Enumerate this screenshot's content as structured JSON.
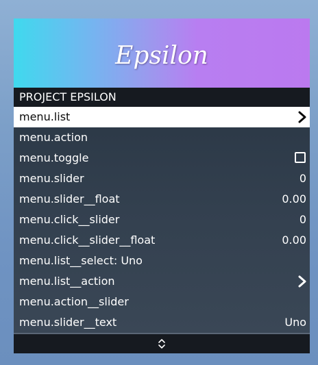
{
  "banner": {
    "title": "Epsilon",
    "gradient_start": "#3fd9ee",
    "gradient_end": "#bb79ef"
  },
  "subtitle": "PROJECT EPSILON",
  "items": [
    {
      "label": "menu.list",
      "value": "",
      "kind": "submenu",
      "selected": true
    },
    {
      "label": "menu.action",
      "value": "",
      "kind": "action"
    },
    {
      "label": "menu.toggle",
      "value": "",
      "kind": "toggle",
      "checked": false
    },
    {
      "label": "menu.slider",
      "value": "0",
      "kind": "slider"
    },
    {
      "label": "menu.slider__float",
      "value": "0.00",
      "kind": "slider"
    },
    {
      "label": "menu.click__slider",
      "value": "0",
      "kind": "slider"
    },
    {
      "label": "menu.click__slider__float",
      "value": "0.00",
      "kind": "slider"
    },
    {
      "label": "menu.list__select: Uno",
      "value": "",
      "kind": "action"
    },
    {
      "label": "menu.list__action",
      "value": "",
      "kind": "submenu"
    },
    {
      "label": "menu.action__slider",
      "value": "",
      "kind": "action"
    },
    {
      "label": "menu.slider__text",
      "value": "Uno",
      "kind": "slider"
    }
  ],
  "footer": {
    "scroll_icon": "up-down-arrows-icon"
  },
  "colors": {
    "selected_bg": "#ffffff",
    "panel_bg": "#33404f",
    "header_bg": "#161a20"
  }
}
